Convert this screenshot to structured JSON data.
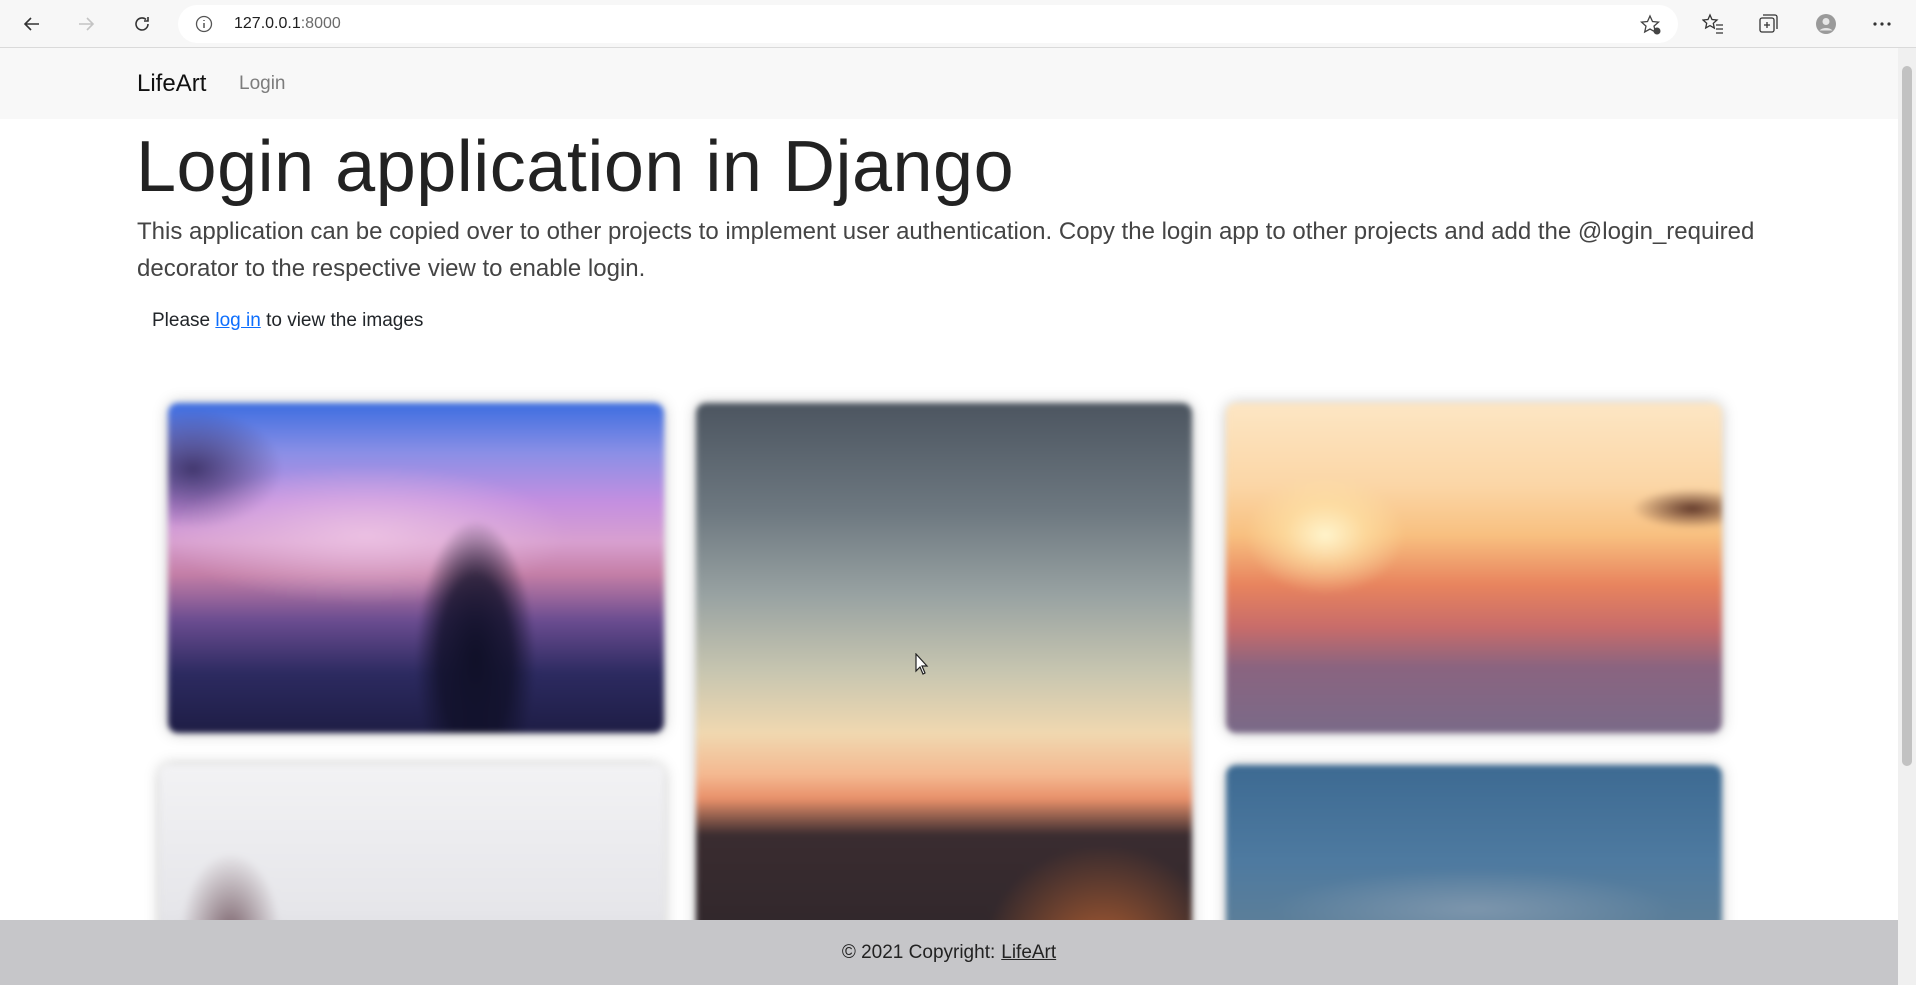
{
  "browser": {
    "url_host": "127.0.0.1",
    "url_port": ":8000"
  },
  "navbar": {
    "brand": "LifeArt",
    "login_link": "Login"
  },
  "main": {
    "title": "Login application in Django",
    "lead": "This application can be copied over to other projects to implement user authentication. Copy the login app to other projects and add the @login_required decorator to the respective view to enable login.",
    "note_prefix": "Please ",
    "note_link": "log in",
    "note_suffix": " to view the images"
  },
  "footer": {
    "copyright": "© 2021 Copyright:",
    "link": "LifeArt"
  }
}
